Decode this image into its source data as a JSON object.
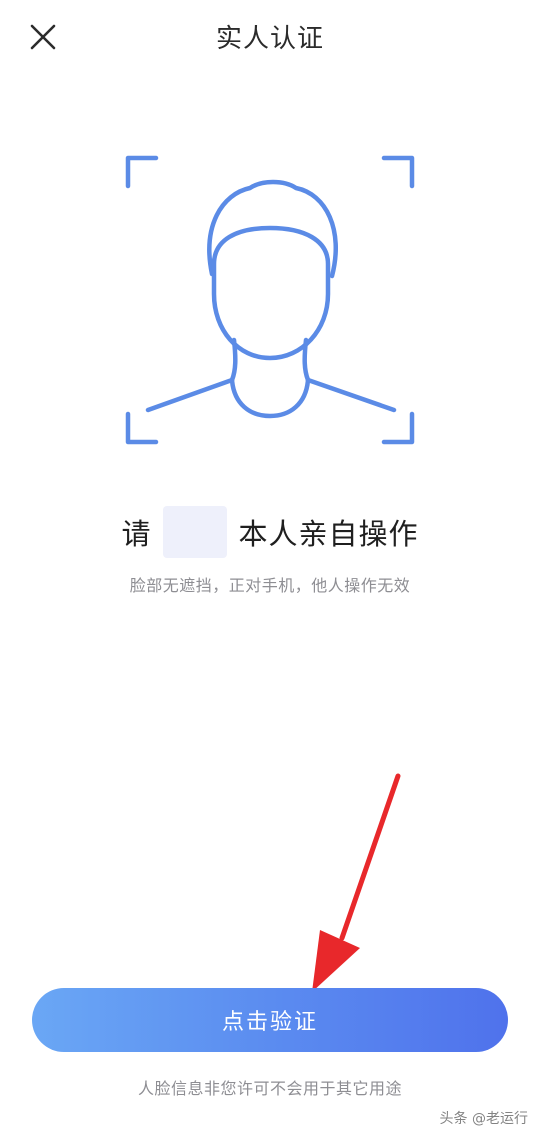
{
  "header": {
    "title": "实人认证",
    "close_icon": "close-icon"
  },
  "illustration": {
    "icon": "face-scan-icon",
    "color": "#5b8be6"
  },
  "prompt": {
    "prefix": "请",
    "suffix": "本人亲自操作"
  },
  "subtitle": "脸部无遮挡，正对手机，他人操作无效",
  "actions": {
    "verify_label": "点击验证"
  },
  "privacy_note": "人脸信息非您许可不会用于其它用途",
  "watermark": "头条 @老运行",
  "colors": {
    "accent": "#5b8cf0",
    "annotation_arrow": "#e8282b"
  }
}
